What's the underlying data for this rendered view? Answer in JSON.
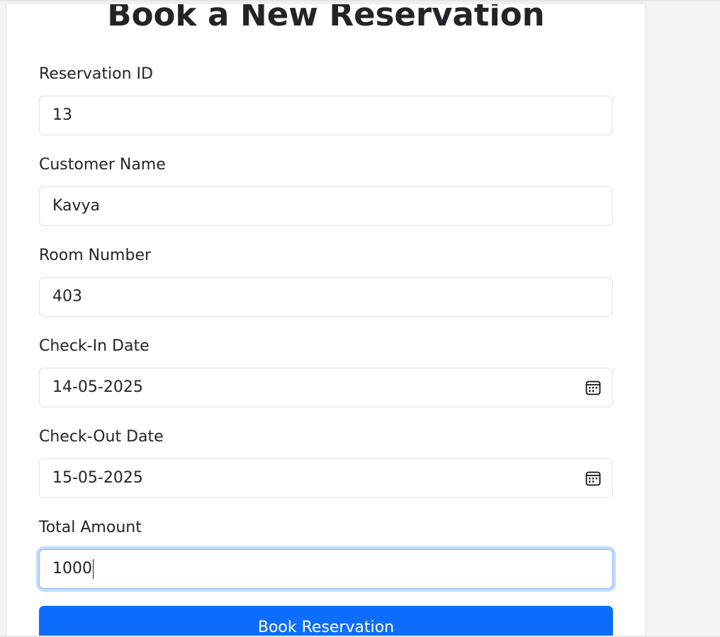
{
  "form": {
    "title": "Book a New Reservation",
    "fields": [
      {
        "label": "Reservation ID",
        "value": "13",
        "type": "text"
      },
      {
        "label": "Customer Name",
        "value": "Kavya",
        "type": "text"
      },
      {
        "label": "Room Number",
        "value": "403",
        "type": "text"
      },
      {
        "label": "Check-In Date",
        "value": "14-05-2025",
        "type": "date"
      },
      {
        "label": "Check-Out Date",
        "value": "15-05-2025",
        "type": "date"
      },
      {
        "label": "Total Amount",
        "value": "1000",
        "type": "text"
      }
    ],
    "submit_label": "Book Reservation"
  },
  "icons": {
    "date_picker": "calendar-icon"
  },
  "colors": {
    "primary": "#0d6efd",
    "focus_ring": "#86b7fe",
    "border": "#dee2e6",
    "page_background": "#f3f4f6",
    "text": "#212529"
  }
}
